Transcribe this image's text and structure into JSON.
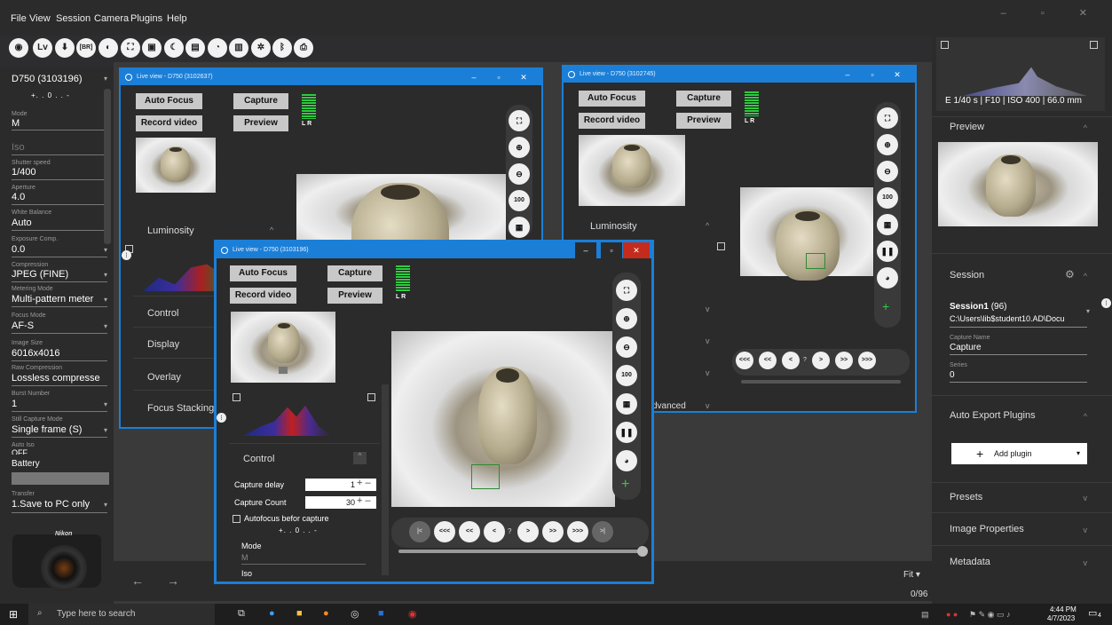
{
  "menu": [
    "File",
    "View",
    "Session",
    "Camera",
    "Plugins",
    "Help"
  ],
  "toolbar": {
    "lv": "Lv",
    "br": "[BR]"
  },
  "left": {
    "camera": "D750 (3103196)",
    "exposure_scale": "+. . 0 . . -",
    "fields": [
      {
        "label": "Mode",
        "value": "M"
      },
      {
        "label": "",
        "value": "Iso"
      },
      {
        "label": "Shutter speed",
        "value": "1/400"
      },
      {
        "label": "Aperture",
        "value": "4.0"
      },
      {
        "label": "White Balance",
        "value": "Auto"
      },
      {
        "label": "Exposure Comp.",
        "value": "0.0"
      },
      {
        "label": "Compression",
        "value": "JPEG (FINE)"
      },
      {
        "label": "Metering Mode",
        "value": "Multi-pattern meter"
      },
      {
        "label": "Focus Mode",
        "value": "AF-S"
      },
      {
        "label": "Image Size",
        "value": "6016x4016"
      },
      {
        "label": "Raw Compression",
        "value": "Lossless compresse"
      },
      {
        "label": "Burst Number",
        "value": "1"
      },
      {
        "label": "Still Capture Mode",
        "value": "Single frame (S)"
      },
      {
        "label": "Auto Iso",
        "value": "OFF"
      }
    ],
    "battery": "Battery",
    "transfer_label": "Transfer",
    "transfer_value": "1.Save to PC only",
    "nikon": "Nikon"
  },
  "win1": {
    "title": "Live view - D750 (3102637)",
    "autofocus": "Auto Focus",
    "capture": "Capture",
    "record": "Record video",
    "preview": "Preview",
    "lr": "L R",
    "sections": [
      "Luminosity",
      "Control",
      "Display",
      "Overlay",
      "Focus Stacking A"
    ],
    "zoom100": "100"
  },
  "win2": {
    "title": "Live view - D750 (3102745)",
    "autofocus": "Auto Focus",
    "capture": "Capture",
    "record": "Record video",
    "preview": "Preview",
    "lr": "L R",
    "sections": [
      "Luminosity"
    ],
    "zoom100": "100",
    "advanced": "dvanced",
    "nav": [
      "<<<",
      "<<",
      "<",
      "?",
      ">",
      ">>",
      ">>>"
    ]
  },
  "win3": {
    "title": "Live view - D750 (3103196)",
    "autofocus": "Auto Focus",
    "capture": "Capture",
    "record": "Record video",
    "preview": "Preview",
    "lr": "L R",
    "control": "Control",
    "capture_delay_label": "Capture delay",
    "capture_delay": "1",
    "capture_count_label": "Capture Count",
    "capture_count": "30",
    "autofocus_before": "Autofocus befor capture",
    "exposure_scale": "+. . 0 . . -",
    "mode_label": "Mode",
    "mode_value": "M",
    "iso_label": "Iso",
    "zoom100": "100",
    "nav": [
      "|<",
      "<<<",
      "<<",
      "<",
      "?",
      ">",
      ">>",
      ">>>",
      ">|"
    ]
  },
  "bottom": {
    "fit": "Fit",
    "count": "0/96"
  },
  "right": {
    "exif": "E 1/40 s | F10 | ISO 400 | 66.0 mm",
    "preview": "Preview",
    "session": "Session",
    "session_name": "Session1",
    "session_count": "(96)",
    "session_path": "C:\\Users\\lib$student10.AD\\Docu",
    "capture_name_label": "Capture Name",
    "capture_name": "Capture",
    "series_label": "Series",
    "series": "0",
    "auto_export": "Auto Export Plugins",
    "add_plugin": "Add plugin",
    "presets": "Presets",
    "image_props": "Image Properties",
    "metadata": "Metadata"
  },
  "taskbar": {
    "search": "Type here to search",
    "time": "4:44 PM",
    "date": "4/7/2023",
    "badge": "4"
  }
}
